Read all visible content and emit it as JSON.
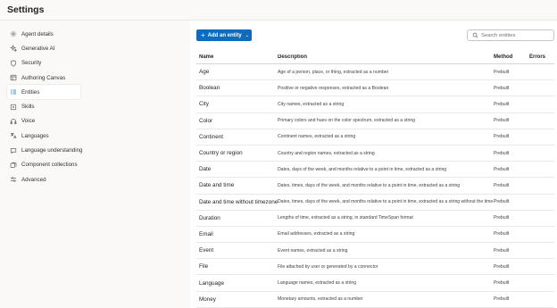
{
  "header": {
    "title": "Settings"
  },
  "sidebar": {
    "items": [
      {
        "label": "Agent details",
        "icon": "gear-icon"
      },
      {
        "label": "Generative AI",
        "icon": "sparkle-icon"
      },
      {
        "label": "Security",
        "icon": "shield-icon"
      },
      {
        "label": "Authoring Canvas",
        "icon": "canvas-icon"
      },
      {
        "label": "Entities",
        "icon": "entities-icon",
        "active": true
      },
      {
        "label": "Skills",
        "icon": "skills-icon"
      },
      {
        "label": "Voice",
        "icon": "voice-icon"
      },
      {
        "label": "Languages",
        "icon": "globe-icon"
      },
      {
        "label": "Language understanding",
        "icon": "chat-icon"
      },
      {
        "label": "Component collections",
        "icon": "collection-icon"
      },
      {
        "label": "Advanced",
        "icon": "sliders-icon"
      }
    ]
  },
  "toolbar": {
    "add_label": "Add an entity",
    "search_placeholder": "Search entities"
  },
  "table": {
    "columns": {
      "name": "Name",
      "description": "Description",
      "method": "Method",
      "errors": "Errors"
    },
    "rows": [
      {
        "name": "Age",
        "description": "Age of a person, place, or thing, extracted as a number",
        "method": "Prebuilt",
        "errors": ""
      },
      {
        "name": "Boolean",
        "description": "Positive or negative responses, extracted as a Boolean",
        "method": "Prebuilt",
        "errors": ""
      },
      {
        "name": "City",
        "description": "City names, extracted as a string",
        "method": "Prebuilt",
        "errors": ""
      },
      {
        "name": "Color",
        "description": "Primary colors and hues on the color spectrum, extracted as a string",
        "method": "Prebuilt",
        "errors": ""
      },
      {
        "name": "Continent",
        "description": "Continent names, extracted as a string",
        "method": "Prebuilt",
        "errors": ""
      },
      {
        "name": "Country or region",
        "description": "Country and region names, extracted as a string",
        "method": "Prebuilt",
        "errors": ""
      },
      {
        "name": "Date",
        "description": "Dates, days of the week, and months relative to a point in time, extracted as a string",
        "method": "Prebuilt",
        "errors": ""
      },
      {
        "name": "Date and time",
        "description": "Dates, times, days of the week, and months relative to a point in time, extracted as a string",
        "method": "Prebuilt",
        "errors": ""
      },
      {
        "name": "Date and time without timezone",
        "description": "Dates, times, days of the week, and months relative to a point in time, extracted as a string without the time...",
        "method": "Prebuilt",
        "errors": ""
      },
      {
        "name": "Duration",
        "description": "Lengths of time, extracted as a string, in standard TimeSpan format",
        "method": "Prebuilt",
        "errors": ""
      },
      {
        "name": "Email",
        "description": "Email addresses, extracted as a string",
        "method": "Prebuilt",
        "errors": ""
      },
      {
        "name": "Event",
        "description": "Event names, extracted as a string",
        "method": "Prebuilt",
        "errors": ""
      },
      {
        "name": "File",
        "description": "File attached by user or generated by a connector",
        "method": "Prebuilt",
        "errors": ""
      },
      {
        "name": "Language",
        "description": "Language names, extracted as a string",
        "method": "Prebuilt",
        "errors": ""
      },
      {
        "name": "Money",
        "description": "Monetary amounts, extracted as a number",
        "method": "Prebuilt",
        "errors": ""
      }
    ]
  },
  "colors": {
    "accent": "#0f6cbd",
    "background": "#faf9f8",
    "surface": "#ffffff"
  }
}
